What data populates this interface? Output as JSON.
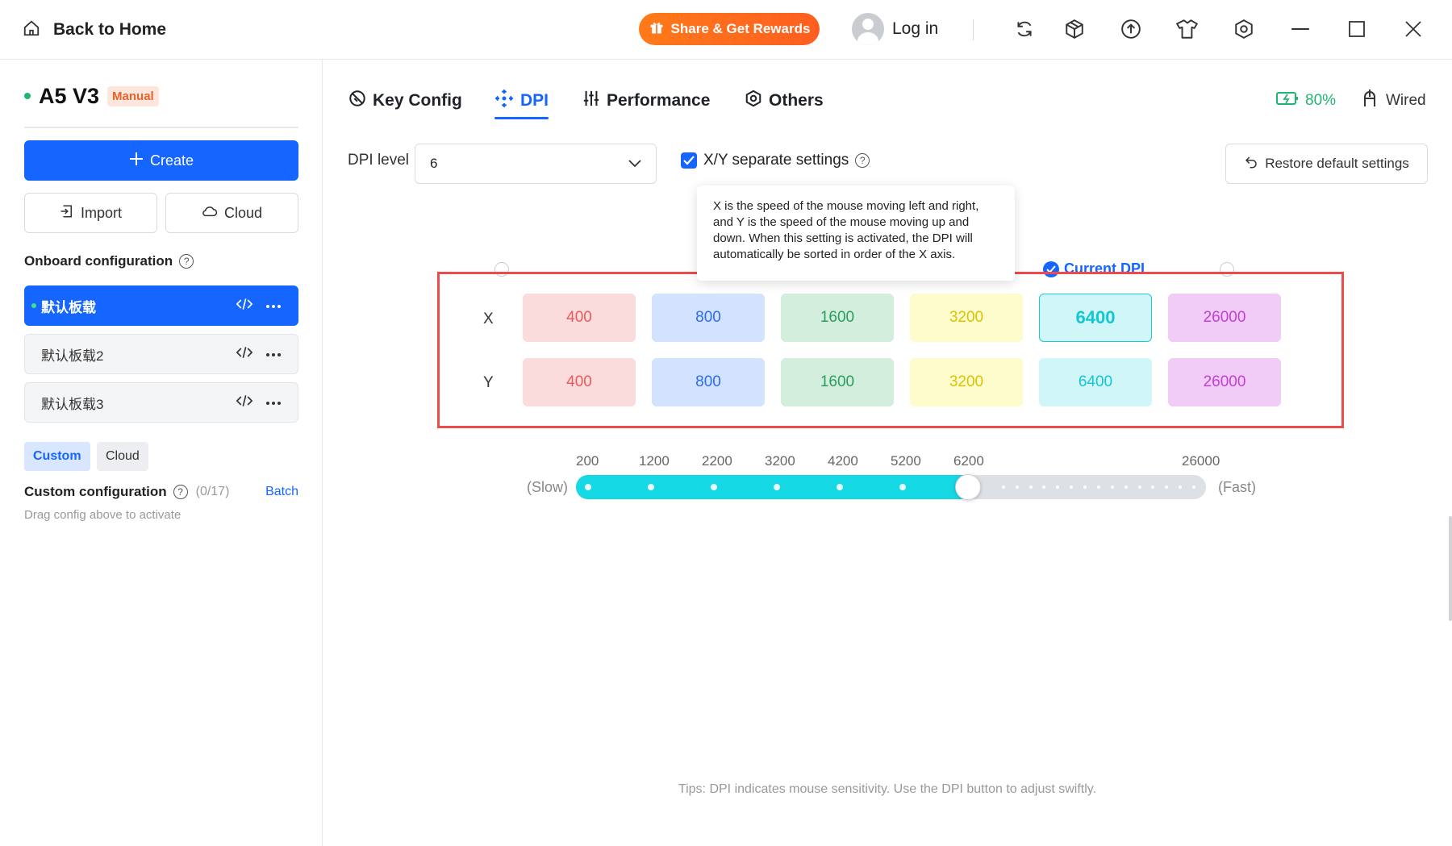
{
  "titlebar": {
    "back_label": "Back to Home",
    "share_label": "Share & Get Rewards",
    "login_label": "Log in",
    "icons": [
      "refresh-icon",
      "cube-icon",
      "upload-icon",
      "shirt-icon",
      "hexagon-settings-icon",
      "minimize-icon",
      "maximize-icon",
      "close-icon"
    ]
  },
  "sidebar": {
    "device_name": "A5 V3",
    "device_mode": "Manual",
    "create_label": "Create",
    "import_label": "Import",
    "cloud_label": "Cloud",
    "onboard_title": "Onboard configuration",
    "configs": [
      {
        "name": "默认板载",
        "active": true
      },
      {
        "name": "默认板载2",
        "active": false
      },
      {
        "name": "默认板载3",
        "active": false
      }
    ],
    "filter_custom": "Custom",
    "filter_cloud": "Cloud",
    "custom_title": "Custom configuration",
    "custom_count": "(0/17)",
    "batch_label": "Batch",
    "drag_hint": "Drag config above to activate"
  },
  "main": {
    "tabs": [
      {
        "label": "Key Config",
        "icon": "no-sign-icon"
      },
      {
        "label": "DPI",
        "icon": "crosshair-arrows-icon",
        "active": true
      },
      {
        "label": "Performance",
        "icon": "sliders-icon"
      },
      {
        "label": "Others",
        "icon": "hexagon-icon"
      }
    ],
    "battery": "80%",
    "connection": "Wired",
    "dpi_level_label": "DPI level",
    "dpi_level_value": "6",
    "xy_label": "X/Y separate settings",
    "restore_label": "Restore default settings",
    "tooltip": "X is the speed of the mouse moving left and right, and Y is the speed of the mouse moving up and down. When this setting is activated, the DPI will automatically be sorted in order of the X axis.",
    "current_dpi_label": "Current DPI",
    "x_label": "X",
    "y_label": "Y",
    "x_values": [
      "400",
      "800",
      "1600",
      "3200",
      "6400",
      "26000"
    ],
    "y_values": [
      "400",
      "800",
      "1600",
      "3200",
      "6400",
      "26000"
    ],
    "current_index": 4,
    "slider": {
      "ticks": [
        "200",
        "1200",
        "2200",
        "3200",
        "4200",
        "5200",
        "6200",
        "26000"
      ],
      "slow_label": "(Slow)",
      "fast_label": "(Fast)",
      "value": 6400,
      "min": 200,
      "max": 26000
    },
    "tips": "Tips: DPI indicates mouse sensitivity. Use the DPI button to adjust swiftly."
  },
  "colors": {
    "accent": "#1565ff",
    "level_bg": [
      "#fbdcdc",
      "#d3e3ff",
      "#d4eedd",
      "#fefbcc",
      "#d0f6f8",
      "#f0ccf7"
    ],
    "level_fg": [
      "#e85a5a",
      "#2f6bea",
      "#2a9e5c",
      "#d9c400",
      "#14c6d4",
      "#c23fd6"
    ]
  }
}
